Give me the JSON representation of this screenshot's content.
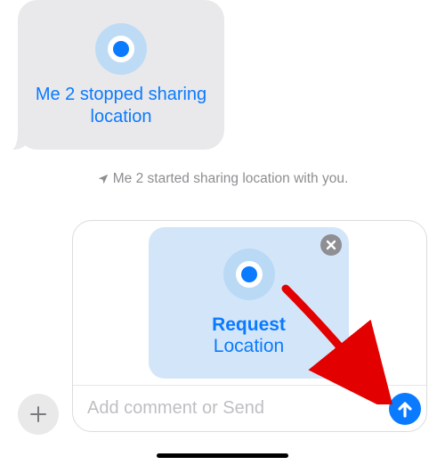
{
  "bubble": {
    "text": "Me 2 stopped sharing location"
  },
  "system_message": {
    "text": "Me 2 started sharing location with you."
  },
  "request_card": {
    "line1": "Request",
    "line2": "Location"
  },
  "compose": {
    "placeholder": "Add comment or Send",
    "value": ""
  },
  "icons": {
    "location_dot": "location-dot-icon",
    "nav_arrow": "navigation-arrow-icon",
    "close": "close-icon",
    "send": "arrow-up-icon",
    "plus": "plus-icon"
  },
  "colors": {
    "accent": "#0a7aff",
    "bubble_bg": "#e9e9eb",
    "request_bg": "#d3e6f9",
    "muted": "#8e8e92"
  }
}
